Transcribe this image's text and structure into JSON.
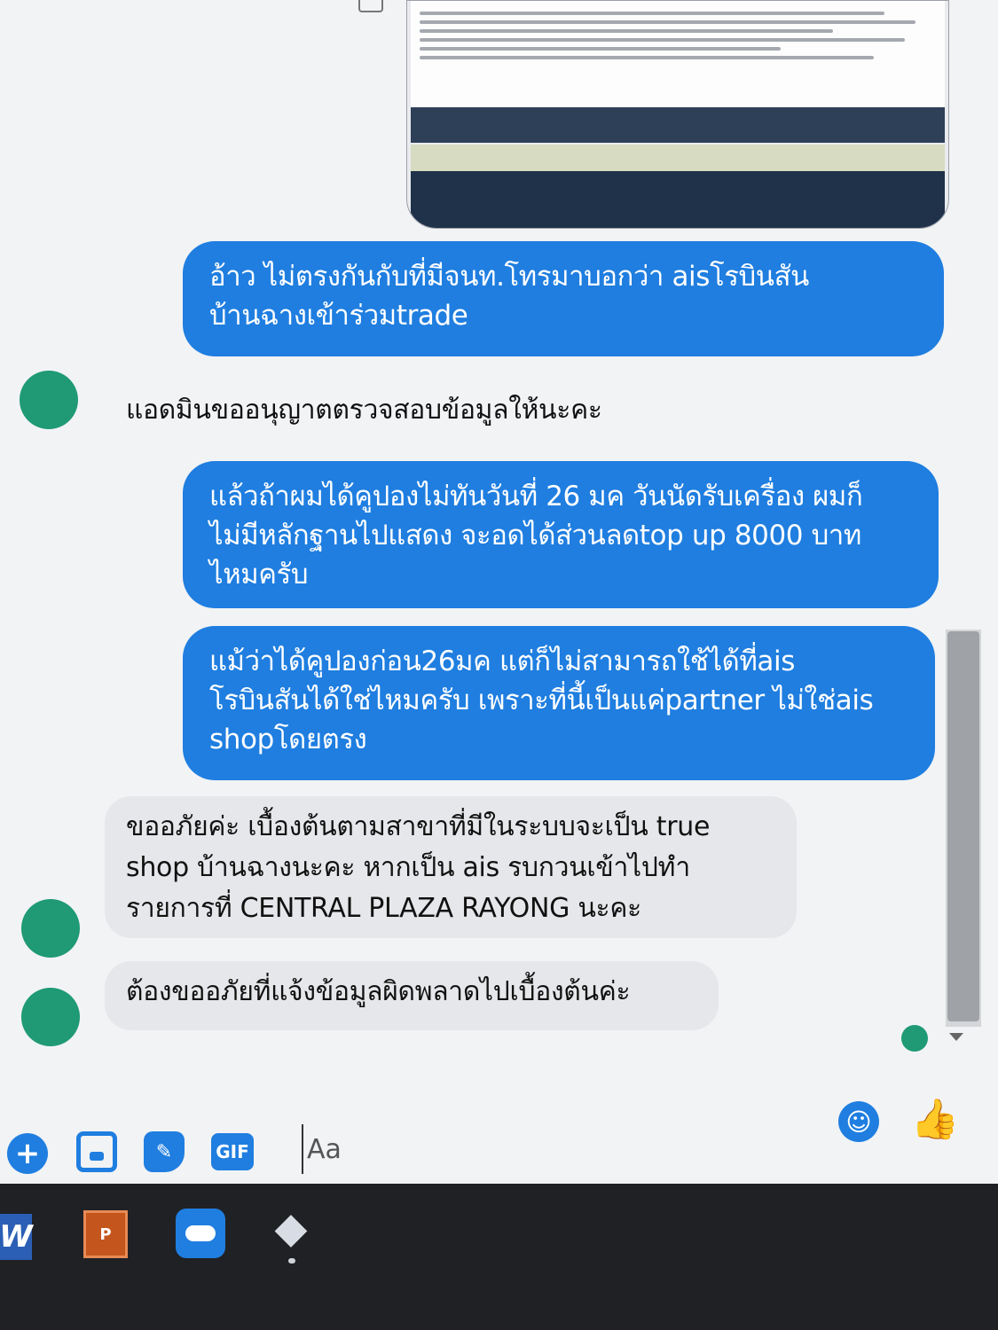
{
  "messages": [
    {
      "side": "out",
      "text_lines": [
        "อ้าว ไม่ตรงกันกับที่มีจนท.โทรมาบอกว่า aisโรบินสัน",
        "บ้านฉางเข้าร่วมtrade"
      ]
    },
    {
      "side": "in",
      "text_lines": [
        "แอดมินขออนุญาตตรวจสอบข้อมูลให้นะคะ"
      ]
    },
    {
      "side": "out",
      "text_lines": [
        "แล้วถ้าผมได้คูปองไม่ทันวันที่ 26 มค วันนัดรับเครื่อง ผมก็",
        "ไม่มีหลักฐานไปแสดง  จะอดได้ส่วนลดtop up 8000 บาท",
        "ไหมครับ"
      ]
    },
    {
      "side": "out",
      "text_lines": [
        "แม้ว่าได้คูปองก่อน26มค  แต่ก็ไม่สามารถใช้ได้ที่ais",
        "โรบินสันได้ใช่ไหมครับ เพราะที่นี้เป็นแค่partner ไม่ใช่ais",
        "shopโดยตรง"
      ]
    },
    {
      "side": "in",
      "text_lines": [
        "ขออภัยค่ะ เบื้องต้นตามสาขาที่มีในระบบจะเป็น true",
        "shop บ้านฉางนะคะ หากเป็น ais รบกวนเข้าไปทำ",
        "รายการที่ CENTRAL PLAZA RAYONG นะคะ"
      ]
    },
    {
      "side": "in",
      "text_lines": [
        "ต้องขออภัยที่แจ้งข้อมูลผิดพลาดไปเบื้องต้นค่ะ"
      ]
    }
  ],
  "composer": {
    "placeholder": "Aa",
    "icons": [
      "plus-icon",
      "photo-icon",
      "sticker-icon",
      "gif-icon",
      "emoji-icon",
      "like-icon"
    ],
    "gif_label": "GIF"
  },
  "taskbar": {
    "icons": [
      "word-icon",
      "powerpoint-icon",
      "onedrive-icon",
      "app-icon"
    ]
  },
  "colors": {
    "outgoing_bubble": "#1f7ee0",
    "incoming_bubble": "#e6e7ea",
    "avatar": "#1f9a74",
    "background": "#f2f3f5"
  }
}
